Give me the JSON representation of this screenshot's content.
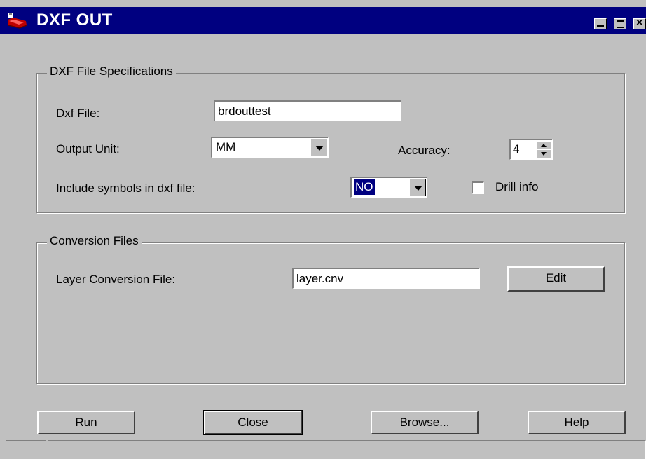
{
  "window": {
    "title": "DXF OUT",
    "icon": "app-icon",
    "controls": [
      "minimize-icon",
      "maximize-icon",
      "close-icon"
    ]
  },
  "spec_group": {
    "legend": "DXF File Specifications",
    "dxf_file_label": "Dxf File:",
    "dxf_file_value": "brdouttest",
    "output_unit_label": "Output Unit:",
    "output_unit_value": "MM",
    "accuracy_label": "Accuracy:",
    "accuracy_value": "4",
    "include_symbols_label": "Include symbols in dxf file:",
    "include_symbols_value": "NO",
    "drill_info_label": "Drill info",
    "drill_info_checked": false
  },
  "conversion_group": {
    "legend": "Conversion Files",
    "layer_conversion_label": "Layer Conversion File:",
    "layer_conversion_value": "layer.cnv",
    "edit_label": "Edit"
  },
  "actions": {
    "run": "Run",
    "close": "Close",
    "browse": "Browse...",
    "help": "Help"
  },
  "colors": {
    "titlebar": "#000080",
    "face": "#c0c0c0"
  }
}
